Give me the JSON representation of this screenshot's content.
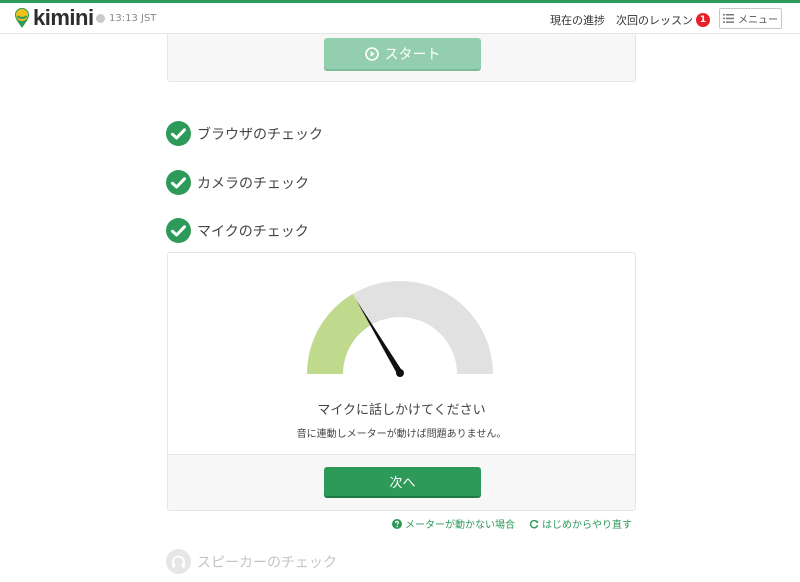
{
  "header": {
    "brand": "kimini",
    "time": "13:13 JST",
    "nav_progress": "現在の進捗",
    "nav_next_lesson": "次回のレッスン",
    "next_lesson_badge": "1",
    "menu_label": "メニュー"
  },
  "start": {
    "button_label": "スタート"
  },
  "checks": {
    "browser": "ブラウザのチェック",
    "camera": "カメラのチェック",
    "mic": "マイクのチェック",
    "speaker": "スピーカーのチェック"
  },
  "mic": {
    "title": "マイクに話しかけてください",
    "subtitle": "音に連動しメーターが動けば問題ありません。",
    "next_label": "次へ",
    "level": 0.33
  },
  "help": {
    "meter_not_moving": "メーターが動かない場合",
    "restart": "はじめからやり直す"
  },
  "colors": {
    "accent": "#2e9a5a",
    "start_disabled": "#93cfae",
    "meter_fill": "#c0da8d",
    "meter_track": "#e1e1e1",
    "badge": "#e8202a"
  }
}
